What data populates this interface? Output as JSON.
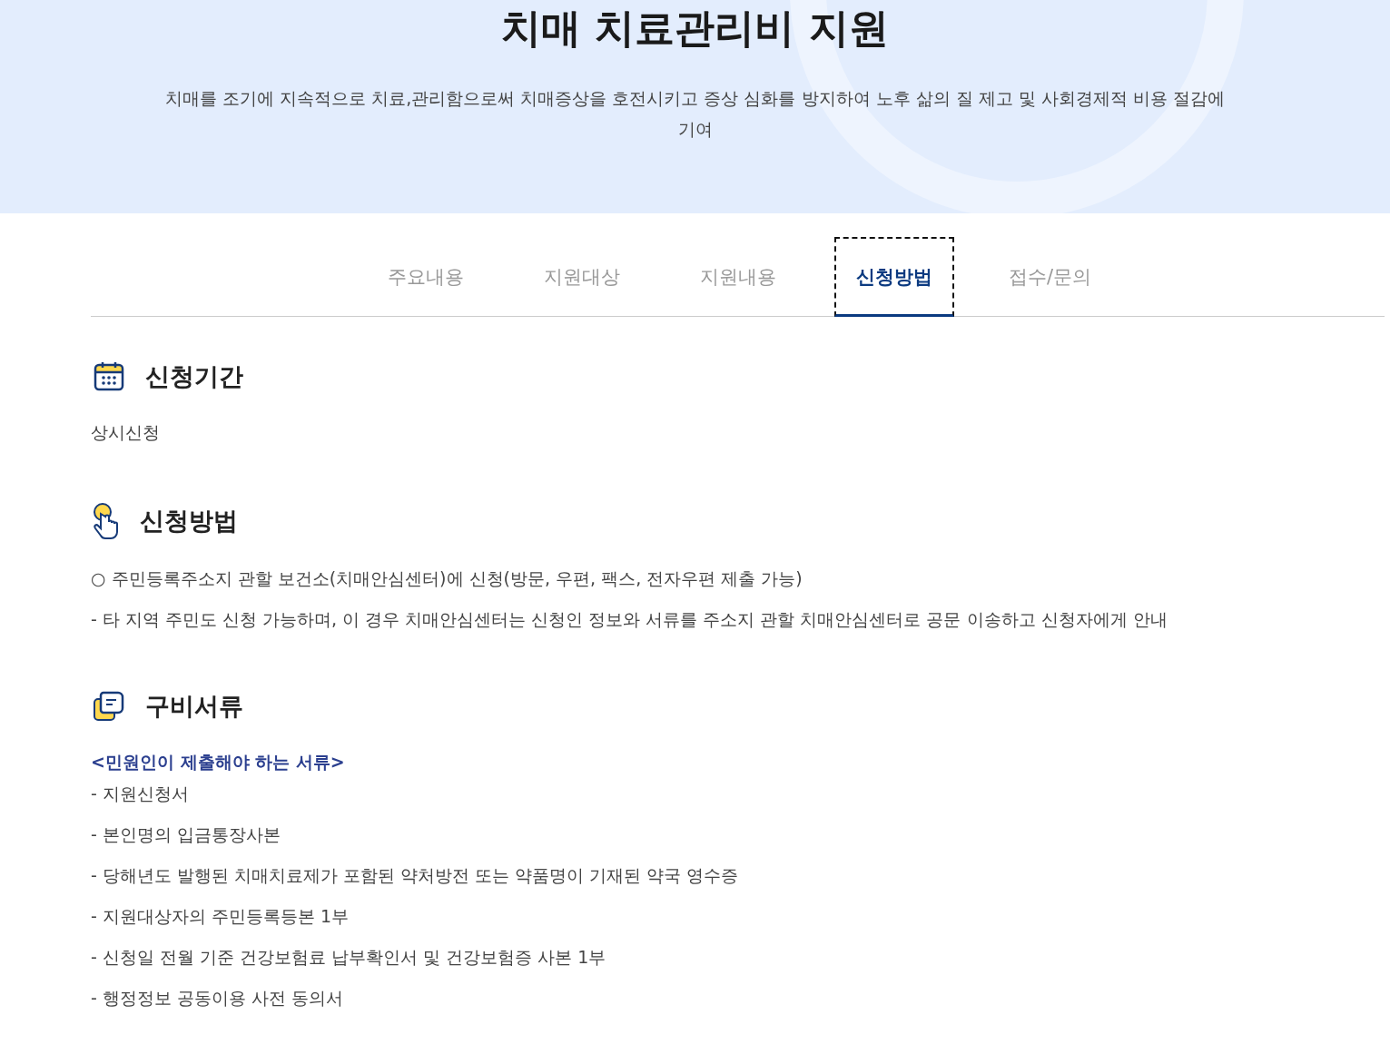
{
  "header": {
    "title": "치매 치료관리비 지원",
    "description": "치매를 조기에 지속적으로 치료,관리함으로써 치매증상을 호전시키고 증상 심화를 방지하여 노후 삶의 질 제고 및 사회경제적 비용 절감에 기여"
  },
  "tabs": [
    {
      "label": "주요내용",
      "selected": false
    },
    {
      "label": "지원대상",
      "selected": false
    },
    {
      "label": "지원내용",
      "selected": false
    },
    {
      "label": "신청방법",
      "selected": true
    },
    {
      "label": "접수/문의",
      "selected": false
    }
  ],
  "sections": [
    {
      "kind": "calendar",
      "title": "신청기간",
      "lines": [
        {
          "kind": "text",
          "text": "상시신청"
        }
      ]
    },
    {
      "kind": "hand",
      "title": "신청방법",
      "lines": [
        {
          "kind": "text",
          "text": "○ 주민등록주소지 관할 보건소(치매안심센터)에 신청(방문, 우편, 팩스, 전자우편 제출 가능)"
        },
        {
          "kind": "text",
          "text": "- 타 지역 주민도 신청 가능하며, 이 경우 치매안심센터는 신청인 정보와 서류를 주소지 관할 치매안심센터로 공문 이송하고 신청자에게 안내"
        }
      ]
    },
    {
      "kind": "docs",
      "title": "구비서류",
      "lines": [
        {
          "kind": "subhead",
          "text": "<민원인이 제출해야 하는 서류>"
        },
        {
          "kind": "text",
          "text": "- 지원신청서"
        },
        {
          "kind": "text",
          "text": "- 본인명의 입금통장사본"
        },
        {
          "kind": "text",
          "text": "- 당해년도 발행된 치매치료제가 포함된 약처방전 또는 약품명이 기재된 약국 영수증"
        },
        {
          "kind": "text",
          "text": "- 지원대상자의 주민등록등본 1부"
        },
        {
          "kind": "text",
          "text": "- 신청일 전월 기준 건강보험료 납부확인서 및 건강보험증 사본 1부"
        },
        {
          "kind": "text",
          "text": "- 행정정보 공동이용 사전 동의서"
        }
      ]
    }
  ]
}
